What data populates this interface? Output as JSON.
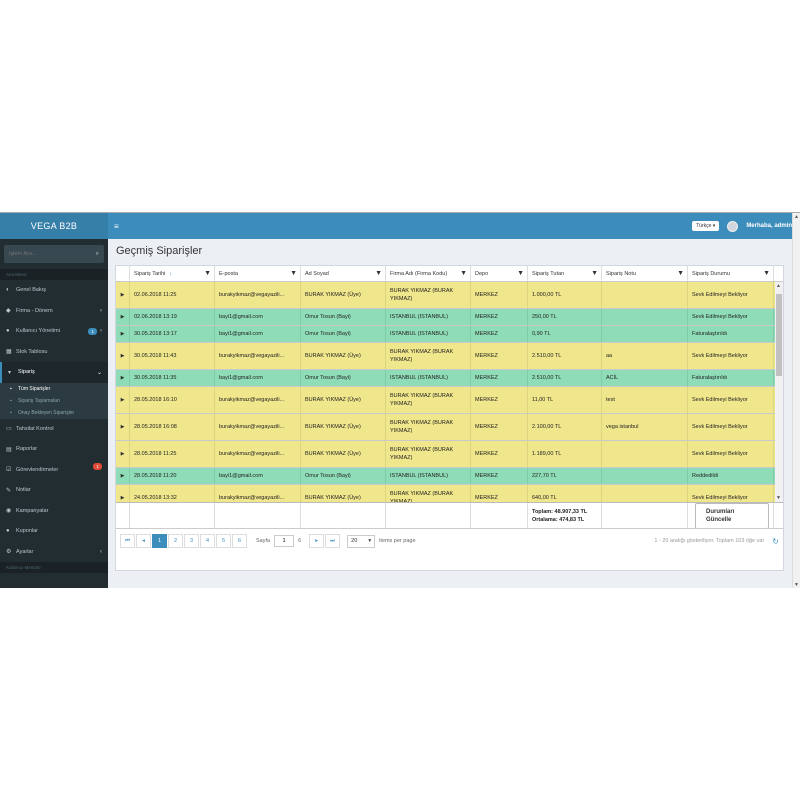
{
  "brand": "VEGA B2B",
  "search": {
    "placeholder": "İşlem Ara..."
  },
  "sidebar": {
    "section_label": "Ana Menü",
    "items": [
      {
        "label": "Genel Bakış",
        "icon": "dashboard-icon"
      },
      {
        "label": "Firma - Dönem",
        "icon": "tag-icon"
      },
      {
        "label": "Kullanıcı Yönetimi",
        "icon": "users-icon",
        "badge": "1"
      },
      {
        "label": "Stok Tablosu",
        "icon": "table-icon"
      },
      {
        "label": "Sipariş",
        "icon": "cart-icon"
      },
      {
        "label": "Tahsilat Kontrol",
        "icon": "money-icon"
      },
      {
        "label": "Raporlar",
        "icon": "report-icon"
      },
      {
        "label": "Görevlendirmeler",
        "icon": "tasks-icon",
        "badge": "1"
      },
      {
        "label": "Notlar",
        "icon": "edit-icon"
      },
      {
        "label": "Kampanyalar",
        "icon": "eye-icon"
      },
      {
        "label": "Kuponlar",
        "icon": "coupon-icon"
      },
      {
        "label": "Ayarlar",
        "icon": "gear-icon"
      }
    ],
    "submenu": [
      {
        "label": "Tüm Siparişler"
      },
      {
        "label": "Sipariş Taşlamaları"
      },
      {
        "label": "Onay Bekleyen Siparişler"
      }
    ],
    "bottom_label": "Kullanıcı Menüsü"
  },
  "header": {
    "language": "Türkçe ▾",
    "user": "Merhaba, admin!"
  },
  "page": {
    "title": "Geçmiş Siparişler"
  },
  "grid": {
    "columns": [
      "Sipariş Tarihi",
      "E-posta",
      "Ad Soyad",
      "Firma Adı (Firma Kodu)",
      "Depo",
      "Sipariş Tutarı",
      "Sipariş Notu",
      "Sipariş Durumu"
    ],
    "rows": [
      {
        "date": "02.06.2018 11:25",
        "email": "burakyikmaz@vegayazili...",
        "name": "BURAK YIKMAZ (Üye)",
        "firm": "BURAK YIKMAZ (BURAK YIKMAZ)",
        "depot": "MERKEZ",
        "amount": "1.000,00 TL",
        "note": "",
        "status": "Sevk Edilmeyi Bekliyor",
        "color": "yellow"
      },
      {
        "date": "02.06.2018 13:19",
        "email": "bayi1@gmail.com",
        "name": "Omur Tosun (Bayi)",
        "firm": "ISTANBUL (ISTANBUL)",
        "depot": "MERKEZ",
        "amount": "250,00 TL",
        "note": "",
        "status": "Sevk Edilmeyi Bekliyor",
        "color": "green"
      },
      {
        "date": "30.05.2018 13:17",
        "email": "bayi1@gmail.com",
        "name": "Omur Tosun (Bayi)",
        "firm": "ISTANBUL (ISTANBUL)",
        "depot": "MERKEZ",
        "amount": "0,90 TL",
        "note": "",
        "status": "Faturalaştırıldı",
        "color": "green"
      },
      {
        "date": "30.05.2018 11:43",
        "email": "burakyikmaz@vegayazili...",
        "name": "BURAK YIKMAZ (Üye)",
        "firm": "BURAK YIKMAZ (BURAK YIKMAZ)",
        "depot": "MERKEZ",
        "amount": "2.510,00 TL",
        "note": "aa",
        "status": "Sevk Edilmeyi Bekliyor",
        "color": "yellow"
      },
      {
        "date": "30.05.2018 11:35",
        "email": "bayi1@gmail.com",
        "name": "Omur Tosun (Bayi)",
        "firm": "ISTANBUL (ISTANBUL)",
        "depot": "MERKEZ",
        "amount": "2.510,00 TL",
        "note": "ACİL",
        "status": "Faturalaştırıldı",
        "color": "green"
      },
      {
        "date": "28.05.2018 16:10",
        "email": "burakyikmaz@vegayazili...",
        "name": "BURAK YIKMAZ (Üye)",
        "firm": "BURAK YIKMAZ (BURAK YIKMAZ)",
        "depot": "MERKEZ",
        "amount": "11,00 TL",
        "note": "test",
        "status": "Sevk Edilmeyi Bekliyor",
        "color": "yellow"
      },
      {
        "date": "28.05.2018 16:08",
        "email": "burakyikmaz@vegayazili...",
        "name": "BURAK YIKMAZ (Üye)",
        "firm": "BURAK YIKMAZ (BURAK YIKMAZ)",
        "depot": "MERKEZ",
        "amount": "2.100,00 TL",
        "note": "vega istanbul",
        "status": "Sevk Edilmeyi Bekliyor",
        "color": "yellow"
      },
      {
        "date": "28.05.2018 11:25",
        "email": "burakyikmaz@vegayazili...",
        "name": "BURAK YIKMAZ (Üye)",
        "firm": "BURAK YIKMAZ (BURAK YIKMAZ)",
        "depot": "MERKEZ",
        "amount": "1.189,00 TL",
        "note": "",
        "status": "Sevk Edilmeyi Bekliyor",
        "color": "yellow"
      },
      {
        "date": "28.05.2018 11:20",
        "email": "bayi1@gmail.com",
        "name": "Omur Tosun (Bayi)",
        "firm": "ISTANBUL (ISTANBUL)",
        "depot": "MERKEZ",
        "amount": "227,70 TL",
        "note": "",
        "status": "Reddedildi",
        "color": "green"
      },
      {
        "date": "24.05.2018 13:32",
        "email": "burakyikmaz@vegayazili...",
        "name": "BURAK YIKMAZ (Üye)",
        "firm": "BURAK YIKMAZ (BURAK YIKMAZ)",
        "depot": "MERKEZ",
        "amount": "640,00 TL",
        "note": "",
        "status": "Sevk Edilmeyi Bekliyor",
        "color": "yellow"
      }
    ],
    "footer": {
      "total": "Toplam: 48.907,33 TL",
      "average": "Ortalama: 474,83 TL",
      "update_button": "Durumları Güncelle"
    }
  },
  "pager": {
    "pages": [
      "1",
      "2",
      "3",
      "4",
      "5",
      "6"
    ],
    "current_page": "1",
    "page_label": "Sayfa",
    "page_value": "1",
    "page_total": "6",
    "page_size": "20",
    "items_per_page": "items per page",
    "info": "1 - 20 aralığı gösteriliyor. Toplam 103 öğe var"
  }
}
